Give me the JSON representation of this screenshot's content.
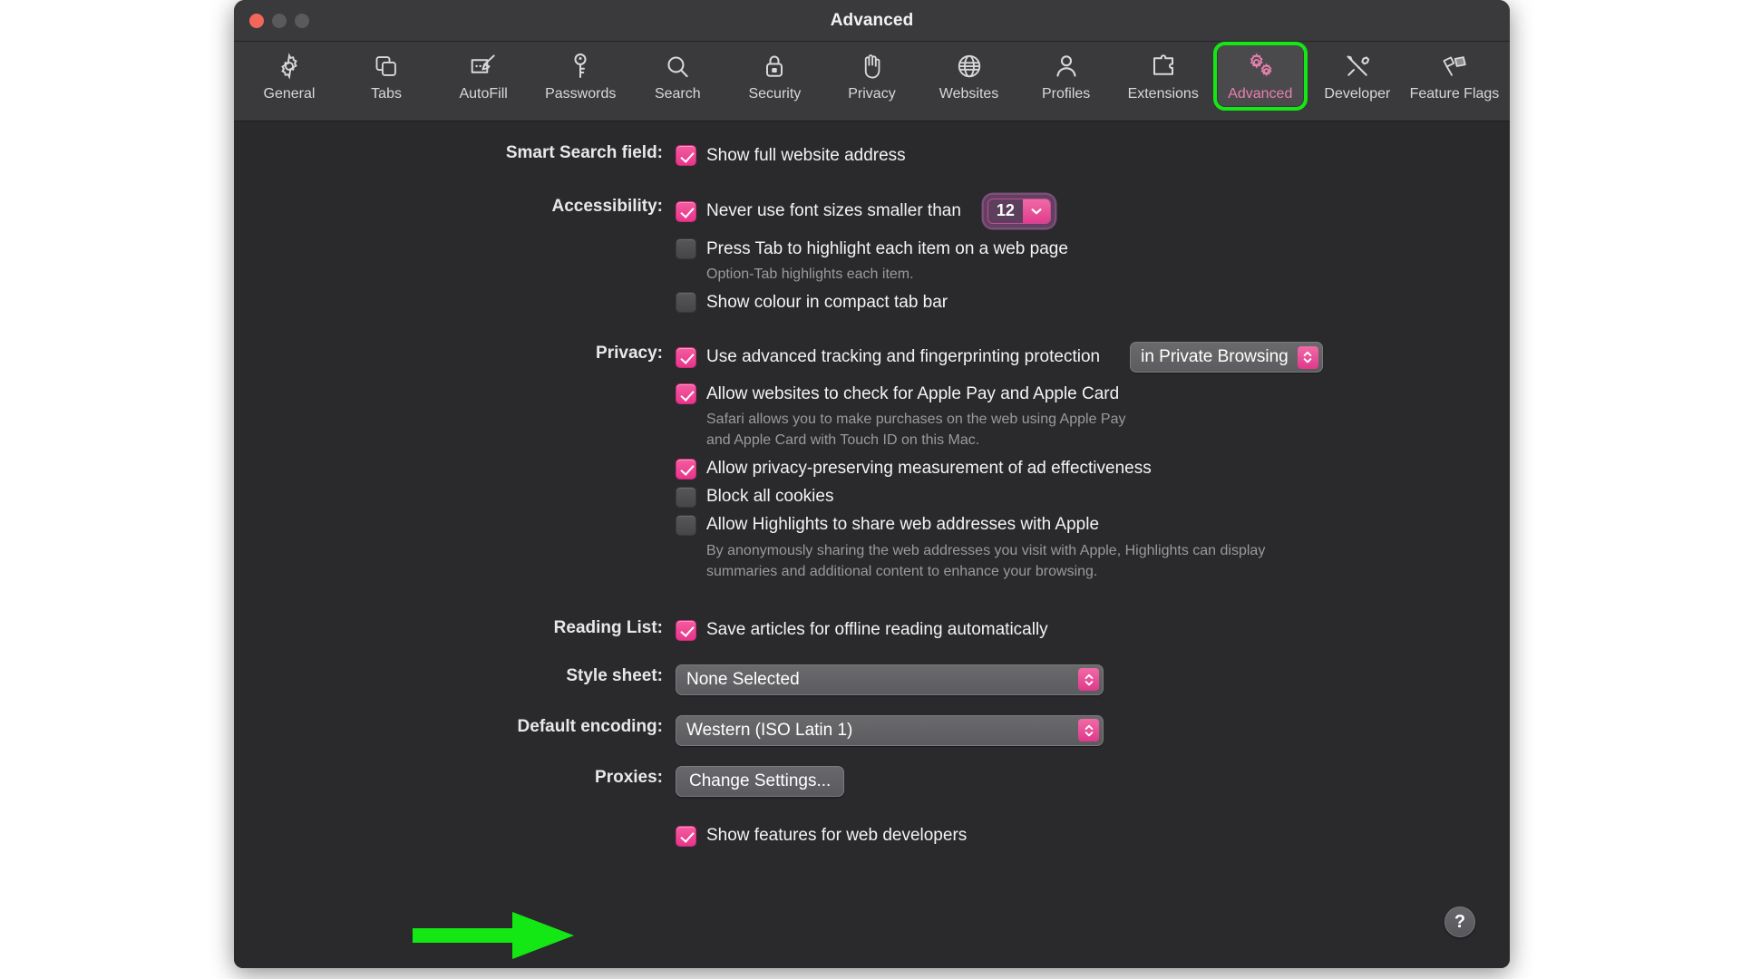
{
  "window": {
    "title": "Advanced",
    "traffic_lights": [
      "close",
      "minimise",
      "zoom"
    ]
  },
  "toolbar": {
    "items": [
      {
        "label": "General",
        "icon": "gear-icon",
        "selected": false
      },
      {
        "label": "Tabs",
        "icon": "tabs-icon",
        "selected": false
      },
      {
        "label": "AutoFill",
        "icon": "autofill-icon",
        "selected": false
      },
      {
        "label": "Passwords",
        "icon": "key-icon",
        "selected": false
      },
      {
        "label": "Search",
        "icon": "magnifier-icon",
        "selected": false
      },
      {
        "label": "Security",
        "icon": "lock-icon",
        "selected": false
      },
      {
        "label": "Privacy",
        "icon": "hand-icon",
        "selected": false
      },
      {
        "label": "Websites",
        "icon": "globe-icon",
        "selected": false
      },
      {
        "label": "Profiles",
        "icon": "person-icon",
        "selected": false
      },
      {
        "label": "Extensions",
        "icon": "puzzle-icon",
        "selected": false
      },
      {
        "label": "Advanced",
        "icon": "gears-icon",
        "selected": true
      },
      {
        "label": "Developer",
        "icon": "tools-icon",
        "selected": false
      },
      {
        "label": "Feature Flags",
        "icon": "flags-icon",
        "selected": false
      }
    ]
  },
  "sections": {
    "smart_search": {
      "label": "Smart Search field:",
      "show_full_address": {
        "text": "Show full website address",
        "checked": true
      }
    },
    "accessibility": {
      "label": "Accessibility:",
      "never_small_fonts": {
        "text": "Never use font sizes smaller than",
        "checked": true
      },
      "font_size_value": "12",
      "press_tab": {
        "text": "Press Tab to highlight each item on a web page",
        "checked": false
      },
      "press_tab_hint": "Option-Tab highlights each item.",
      "show_colour_tab_bar": {
        "text": "Show colour in compact tab bar",
        "checked": false
      }
    },
    "privacy": {
      "label": "Privacy:",
      "advanced_tracking": {
        "text": "Use advanced tracking and fingerprinting protection",
        "checked": true
      },
      "tracking_scope": "in Private Browsing",
      "apple_pay": {
        "text": "Allow websites to check for Apple Pay and Apple Card",
        "checked": true
      },
      "apple_pay_hint_line1": "Safari allows you to make purchases on the web using Apple Pay",
      "apple_pay_hint_line2": "and Apple Card with Touch ID on this Mac.",
      "ad_measurement": {
        "text": "Allow privacy-preserving measurement of ad effectiveness",
        "checked": true
      },
      "block_cookies": {
        "text": "Block all cookies",
        "checked": false
      },
      "highlights": {
        "text": "Allow Highlights to share web addresses with Apple",
        "checked": false
      },
      "highlights_hint_line1": "By anonymously sharing the web addresses you visit with Apple, Highlights can display",
      "highlights_hint_line2": "summaries and additional content to enhance your browsing."
    },
    "reading_list": {
      "label": "Reading List:",
      "save_offline": {
        "text": "Save articles for offline reading automatically",
        "checked": true
      }
    },
    "style_sheet": {
      "label": "Style sheet:",
      "value": "None Selected"
    },
    "default_encoding": {
      "label": "Default encoding:",
      "value": "Western (ISO Latin 1)"
    },
    "proxies": {
      "label": "Proxies:",
      "button": "Change Settings..."
    },
    "web_developers": {
      "text": "Show features for web developers",
      "checked": true
    }
  },
  "help": {
    "glyph": "?"
  },
  "annotation": {
    "arrow_colour": "#14e814",
    "highlight_colour": "#14e814"
  },
  "colors": {
    "accent_pink": "#e8358c",
    "window_bg": "#2a2a2c",
    "toolbar_bg": "#3a3a3c",
    "text": "#f3f3f5",
    "muted_text": "#9a9a9e"
  }
}
